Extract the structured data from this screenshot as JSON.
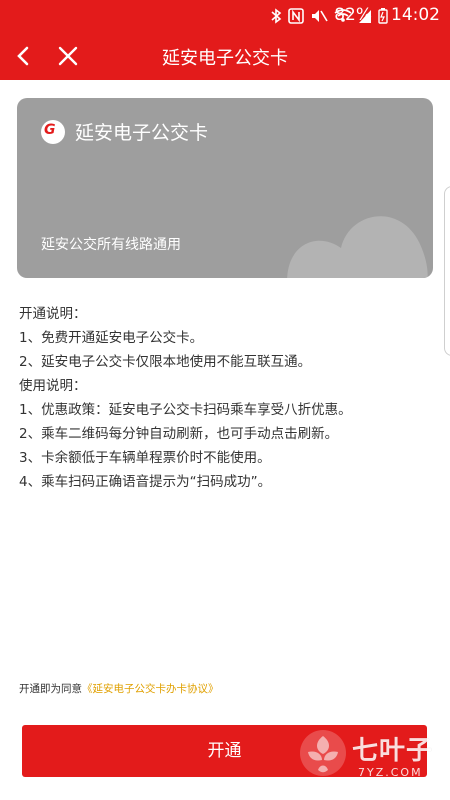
{
  "status_bar": {
    "battery_percent": "82%",
    "time": "14:02"
  },
  "app_bar": {
    "title": "延安电子公交卡"
  },
  "card": {
    "title": "延安电子公交卡",
    "subtitle": "延安公交所有线路通用",
    "logo_text": "G"
  },
  "info": {
    "lines": [
      "开通说明：",
      "1、免费开通延安电子公交卡。",
      "2、延安电子公交卡仅限本地使用不能互联互通。",
      "使用说明：",
      "1、优惠政策：延安电子公交卡扫码乘车享受八折优惠。",
      "2、乘车二维码每分钟自动刷新，也可手动点击刷新。",
      "3、卡余额低于车辆单程票价时不能使用。",
      "4、乘车扫码正确语音提示为“扫码成功”。"
    ]
  },
  "agreement": {
    "prefix": "开通即为同意",
    "link": "《延安电子公交卡办卡协议》"
  },
  "button": {
    "label": "开通"
  },
  "watermark": {
    "cn": "七叶子",
    "en": "7YZ.COM"
  },
  "colors": {
    "primary": "#e31b1b",
    "card_bg": "#9e9e9e",
    "link": "#e0a000"
  }
}
